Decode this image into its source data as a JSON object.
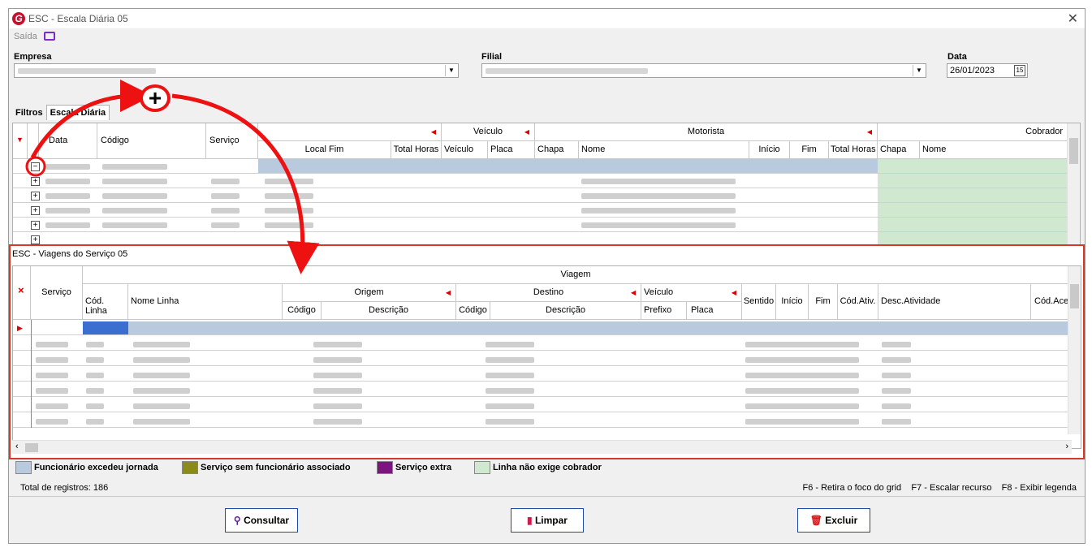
{
  "window": {
    "title": "ESC - Escala Diária 05",
    "close": "✕",
    "saida_label": "Saída"
  },
  "filters": {
    "empresa_label": "Empresa",
    "filial_label": "Filial",
    "data_label": "Data",
    "data_value": "26/01/2023",
    "cal_glyph": "15"
  },
  "tabs": [
    {
      "label": "Filtros"
    },
    {
      "label": "Escala Diária"
    }
  ],
  "main_grid": {
    "group_headers": {
      "veiculo": "Veículo",
      "motorista": "Motorista",
      "cobrador": "Cobrador"
    },
    "columns": [
      "Data",
      "Código",
      "Serviço",
      "Local Fim",
      "Total Horas",
      "Veículo",
      "Placa",
      "Chapa",
      "Nome",
      "Início",
      "Fim",
      "Total Horas",
      "Chapa",
      "Nome"
    ],
    "expand_collapsed": "+",
    "expand_expanded": "−"
  },
  "sub_window": {
    "title": "ESC - Viagens do Serviço 05",
    "group_headers": {
      "viagem": "Viagem",
      "origem": "Origem",
      "destino": "Destino",
      "veiculo": "Veículo"
    },
    "columns": {
      "servico": "Serviço",
      "cod_linha": "Cód. Linha",
      "nome_linha": "Nome Linha",
      "origem_codigo": "Código",
      "origem_descricao": "Descrição",
      "destino_codigo": "Código",
      "destino_descricao": "Descrição",
      "prefixo": "Prefixo",
      "placa": "Placa",
      "sentido": "Sentido",
      "inicio": "Início",
      "fim": "Fim",
      "cod_ativ": "Cód.Ativ.",
      "desc_atividade": "Desc.Atividade",
      "cod_aces": "Cód.Aces"
    },
    "delete_glyph": "×"
  },
  "legend": [
    {
      "label": "Funcionário excedeu jornada",
      "color": "#b9c9de"
    },
    {
      "label": "Serviço sem funcionário associado",
      "color": "#8b8a1a"
    },
    {
      "label": "Serviço extra",
      "color": "#7c1580"
    },
    {
      "label": "Linha não exige cobrador",
      "color": "#cfe8cf"
    }
  ],
  "status": {
    "total": "Total de registros: 186",
    "f6": "F6 - Retira o foco do grid",
    "f7": "F7 - Escalar recurso",
    "f8": "F8 - Exibir legenda"
  },
  "buttons": {
    "consultar": "Consultar",
    "limpar": "Limpar",
    "excluir": "Excluir"
  },
  "annotation": {
    "plus_glyph": "+"
  }
}
